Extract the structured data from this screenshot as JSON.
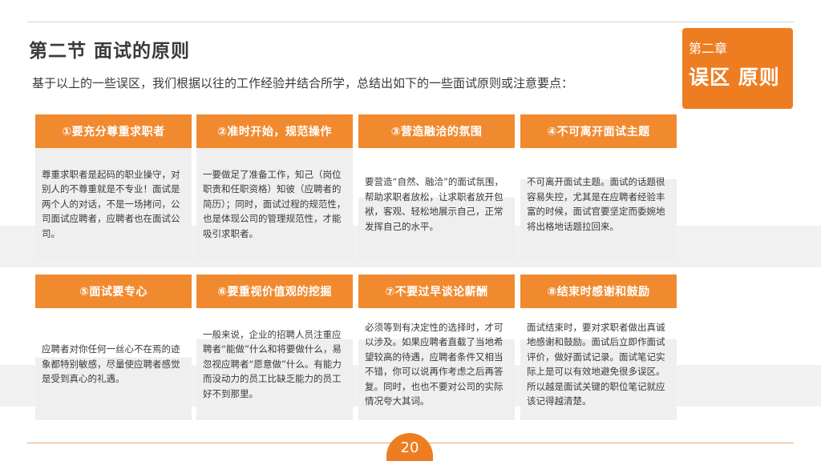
{
  "header": {
    "title": "第二节  面试的原则",
    "subtitle": "基于以上的一些误区，我们根据以往的工作经验并结合所学，总结出如下的一些面试原则或注意要点："
  },
  "chapter": {
    "label": "第二章",
    "name": "误区 原则"
  },
  "principles": [
    {
      "heading": "①要充分尊重求职者",
      "text": "尊重求职者是起码的职业操守，对别人的不尊重就是不专业！面试是两个人的对话，不是一场拷问，公司面试应聘者，应聘者也在面试公司。"
    },
    {
      "heading": "②准时开始，规范操作",
      "text": "一要做足了准备工作，知己（岗位职责和任职资格）知彼（应聘者的简历）；同时，面试过程的规范性，也是体现公司的管理规范性，才能吸引求职者。"
    },
    {
      "heading": "③营造融洽的氛围",
      "text": "要营造“自然、融洽”的面试氛围，帮助求职者放松，让求职者放开包袱，客观、轻松地展示自己，正常发挥自己的水平。"
    },
    {
      "heading": "④不可离开面试主题",
      "text": "不可离开面试主题。面试的话题很容易失控，尤其是在应聘者经验丰富的时候，面试官要坚定而委婉地将出格地话题拉回来。"
    },
    {
      "heading": "⑤面试要专心",
      "text": "应聘者对你任何一丝心不在焉的迹象都特别敏感，尽量使应聘者感觉是受到真心的礼遇。"
    },
    {
      "heading": "⑥要重视价值观的挖掘",
      "text": "一般来说，企业的招聘人员注重应聘者“能做”什么和将要做什么，易忽视应聘者“愿意做”什么。有能力而没动力的员工比缺乏能力的员工好不到那里。"
    },
    {
      "heading": "⑦不要过早谈论薪酬",
      "text": "必须等到有决定性的选择时，才可以涉及。如果应聘者直截了当地希望较高的待遇，应聘者条件又相当不错，你可以说再作考虑之后再答复。同时，也也不要对公司的实际情况夸大其词。"
    },
    {
      "heading": "⑧结束时感谢和鼓励",
      "text": "面试结束时，要对求职者做出真诚地感谢和鼓励。面试后立即作面试评价，做好面试记录。面试笔记实际上是可以有效地避免很多误区。所以越是面试关键的职位笔记就应该记得越清楚。"
    }
  ],
  "footer": {
    "page_number": "20"
  },
  "colors": {
    "accent": "#ee7d22",
    "card_head": "#f18a2f",
    "card_body": "#efefef"
  }
}
